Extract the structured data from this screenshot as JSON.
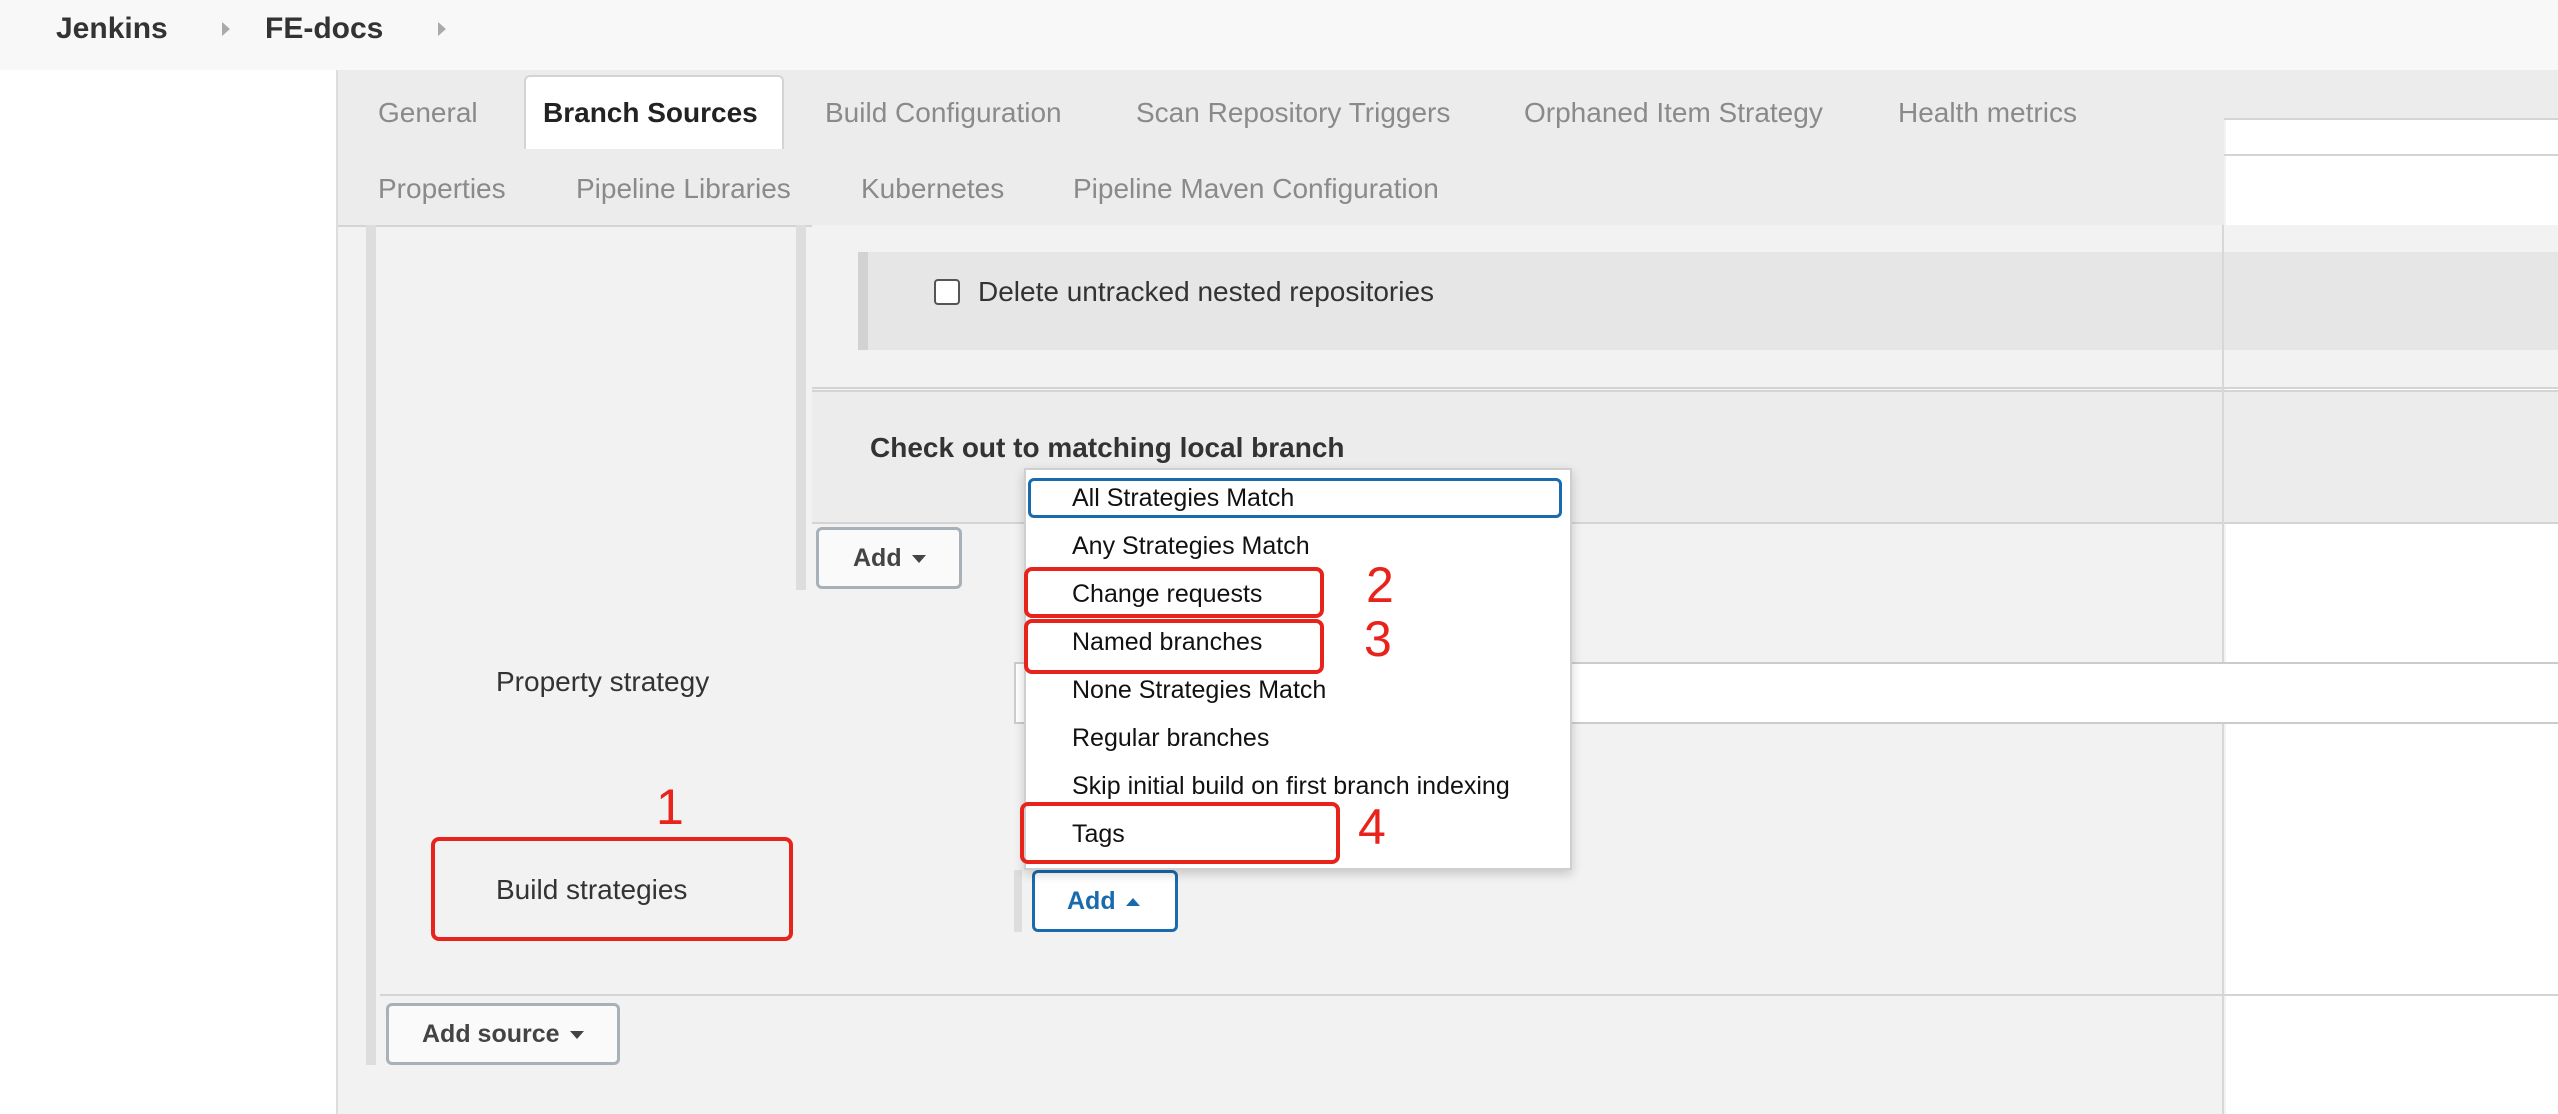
{
  "breadcrumb": {
    "items": [
      "Jenkins",
      "FE-docs"
    ]
  },
  "tabs": {
    "row1": [
      "General",
      "Branch Sources",
      "Build Configuration",
      "Scan Repository Triggers",
      "Orphaned Item Strategy",
      "Health metrics"
    ],
    "row2": [
      "Properties",
      "Pipeline Libraries",
      "Kubernetes",
      "Pipeline Maven Configuration"
    ],
    "active": "Branch Sources"
  },
  "form": {
    "delete_untracked_label": "Delete untracked nested repositories",
    "delete_untracked_checked": false,
    "checkout_label": "Check out to matching local branch",
    "add_button_1": "Add",
    "property_strategy_label": "Property strategy",
    "build_strategies_label": "Build strategies",
    "add_button_2": "Add",
    "add_source_button": "Add source"
  },
  "dropdown": {
    "items": [
      "All Strategies Match",
      "Any Strategies Match",
      "Change requests",
      "Named branches",
      "None Strategies Match",
      "Regular branches",
      "Skip initial build on first branch indexing",
      "Tags"
    ],
    "focused": "All Strategies Match"
  },
  "annotations": {
    "labels": [
      "1",
      "2",
      "3",
      "4"
    ],
    "color": "#e8231c"
  },
  "colors": {
    "accent": "#1a6bad",
    "annotation": "#e8231c"
  }
}
